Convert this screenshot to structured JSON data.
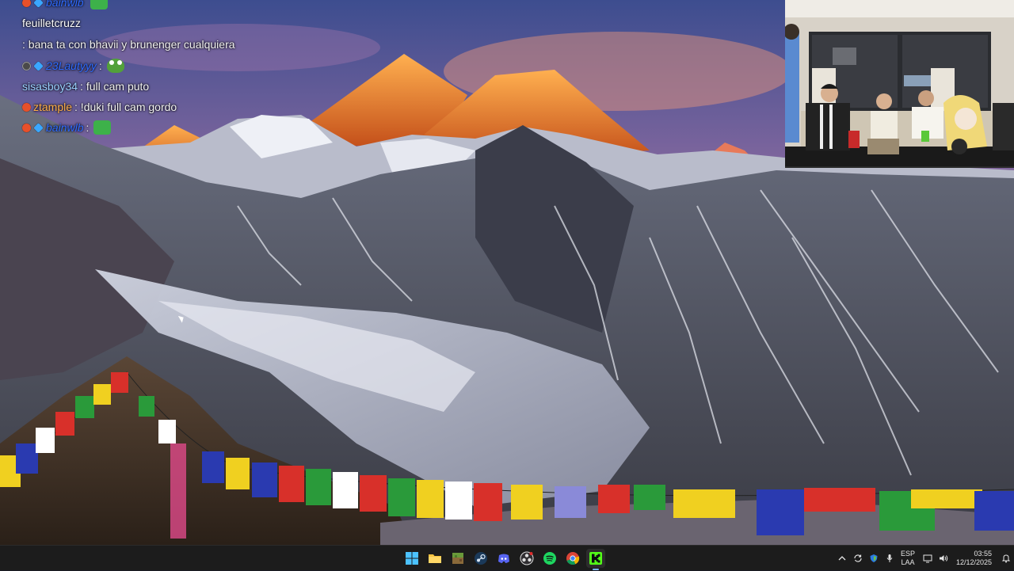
{
  "chat": {
    "messages": [
      {
        "user": "bainwlb",
        "text": "",
        "badges": [
          "red",
          "gem"
        ],
        "name_color": "blue",
        "emote": "green-emote"
      },
      {
        "user": "feuilletcruzz",
        "text": ": bana ta con bhavii y brunenger cualquiera",
        "badges": [],
        "name_color": "white"
      },
      {
        "user": "23Lautyyy",
        "text": ":",
        "badges": [
          "dark",
          "gem"
        ],
        "name_color": "blue",
        "emote": "frog-emote"
      },
      {
        "user": "sisasboy34",
        "text": ": full cam puto",
        "badges": [],
        "name_color": "lightblue"
      },
      {
        "user": "ztample",
        "text": ": !duki full cam gordo",
        "badges": [
          "red"
        ],
        "name_color": "orange"
      },
      {
        "user": "bainwlb",
        "text": ":",
        "badges": [
          "red",
          "gem"
        ],
        "name_color": "blue",
        "emote": "green-emote"
      }
    ]
  },
  "taskbar": {
    "apps": [
      {
        "name": "windows-start-icon",
        "active": false
      },
      {
        "name": "file-explorer-icon",
        "active": false
      },
      {
        "name": "minecraft-icon",
        "active": false
      },
      {
        "name": "steam-icon",
        "active": false
      },
      {
        "name": "discord-icon",
        "active": false
      },
      {
        "name": "obs-icon",
        "active": false
      },
      {
        "name": "spotify-icon",
        "active": false
      },
      {
        "name": "chrome-icon",
        "active": false
      },
      {
        "name": "kick-icon",
        "active": true
      }
    ],
    "tray": {
      "language_top": "ESP",
      "language_bottom": "LAA",
      "time": "03:55",
      "date": "12/12/2025"
    }
  },
  "colors": {
    "taskbar_bg": "#1c1c1c",
    "sky_top": "#4a5fa8",
    "sky_glow": "#f0906a",
    "peak_glow": "#ff8a2a",
    "kick_green": "#53fc18"
  }
}
